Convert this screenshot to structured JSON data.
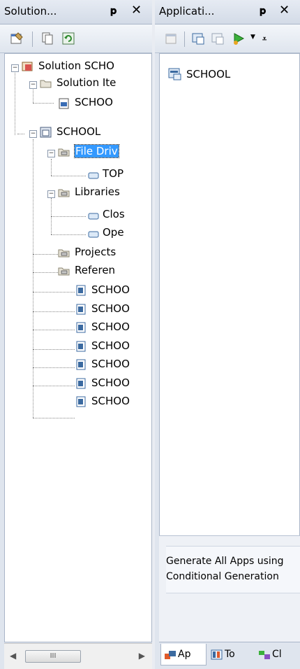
{
  "solution_pane": {
    "title": "Solution...",
    "pin": "&#x1F4CC;",
    "close": "✕",
    "tree": {
      "root_label": "Solution SCHO",
      "solution_items_label": "Solution Ite",
      "schoo_file_label": "SCHOO",
      "project_label": "SCHOOL",
      "file_drivers_label": "File Driv",
      "top_label": "TOP",
      "libraries_label": "Libraries",
      "clos_label": "Clos",
      "ope_label": "Ope",
      "projects_label": "Projects",
      "references_label": "Referen",
      "modules": [
        "SCHOO",
        "SCHOO",
        "SCHOO",
        "SCHOO",
        "SCHOO",
        "SCHOO",
        "SCHOO"
      ]
    },
    "scroll_thumb_grip": "III"
  },
  "applications_pane": {
    "title": "Applicati...",
    "close": "✕",
    "app_item": "SCHOOL",
    "description_line1": "Generate All Apps using",
    "description_line2": "Conditional Generation",
    "tabs": [
      "Ap",
      "To",
      "Cl"
    ]
  }
}
